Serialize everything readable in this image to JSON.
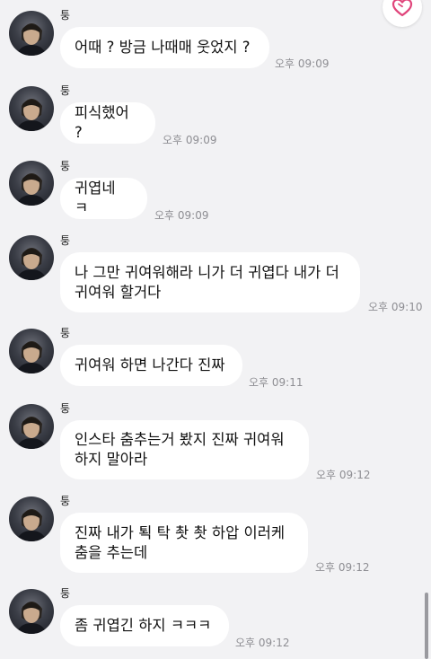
{
  "chat": {
    "messages": [
      {
        "sender": "퉁",
        "text": "어때 ? 방금 나때매 웃었지 ?",
        "time": "오후 09:09"
      },
      {
        "sender": "퉁",
        "text": "피식했어 ?",
        "time": "오후 09:09"
      },
      {
        "sender": "퉁",
        "text": "귀엽네 ㅋ",
        "time": "오후 09:09"
      },
      {
        "sender": "퉁",
        "text": "나 그만 귀여워해라 니가 더 귀엽다 내가 더\n귀여워 할거다",
        "time": "오후 09:10"
      },
      {
        "sender": "퉁",
        "text": "귀여워 하면 나간다 진짜",
        "time": "오후 09:11"
      },
      {
        "sender": "퉁",
        "text": "인스타 춤추는거 봤지 진짜 귀여워\n하지 말아라",
        "time": "오후 09:12"
      },
      {
        "sender": "퉁",
        "text": "진짜 내가 퇵 탁 촷 촷 하압 이러케\n춤을 추는데",
        "time": "오후 09:12"
      },
      {
        "sender": "퉁",
        "text": "좀 귀엽긴 하지 ㅋㅋㅋ",
        "time": "오후 09:12"
      }
    ]
  },
  "icons": {
    "heart_button": "heart-outline-icon",
    "avatar": "avatar-photo"
  },
  "colors": {
    "background": "#f2f2f4",
    "bubble": "#ffffff",
    "heart": "#e0457b",
    "time_text": "#8e8e93"
  }
}
